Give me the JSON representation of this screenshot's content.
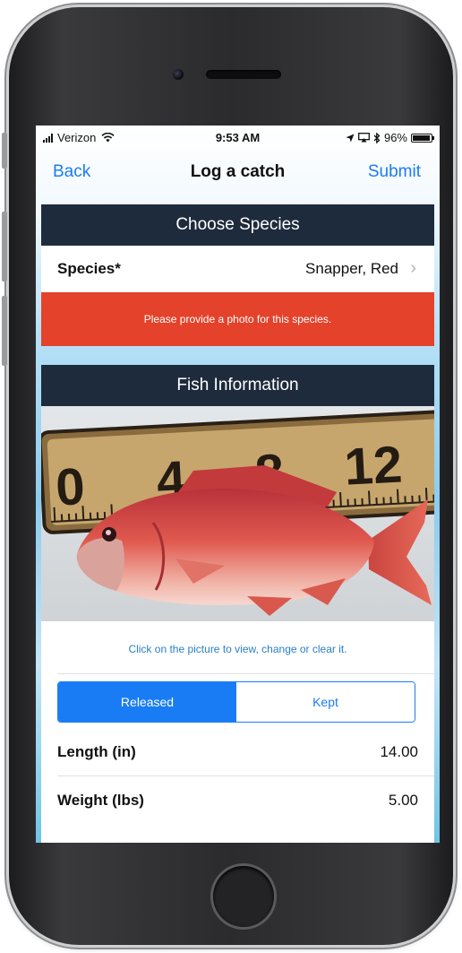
{
  "status_bar": {
    "carrier": "Verizon",
    "time": "9:53 AM",
    "battery": "96%",
    "battery_level": 0.96
  },
  "nav": {
    "back": "Back",
    "title": "Log a catch",
    "submit": "Submit"
  },
  "species_section": {
    "header": "Choose Species",
    "species_label": "Species*",
    "species_value": "Snapper, Red",
    "alert": "Please provide a photo for this species."
  },
  "fish_section": {
    "header": "Fish Information",
    "ruler_numbers": [
      "0",
      "4",
      "8",
      "12"
    ],
    "photo_hint": "Click on the picture to view, change or clear it.",
    "segments": [
      {
        "label": "Released",
        "selected": true
      },
      {
        "label": "Kept",
        "selected": false
      }
    ],
    "length_label": "Length (in)",
    "length_value": "14.00",
    "weight_label": "Weight (lbs)",
    "weight_value": "5.00"
  },
  "colors": {
    "accent": "#1a7cf5",
    "section_header": "#1e2b3d",
    "alert": "#e4422b"
  },
  "icons": [
    "signal-icon",
    "wifi-icon",
    "location-icon",
    "airplay-icon",
    "bluetooth-icon",
    "battery-icon",
    "chevron-right-icon"
  ]
}
